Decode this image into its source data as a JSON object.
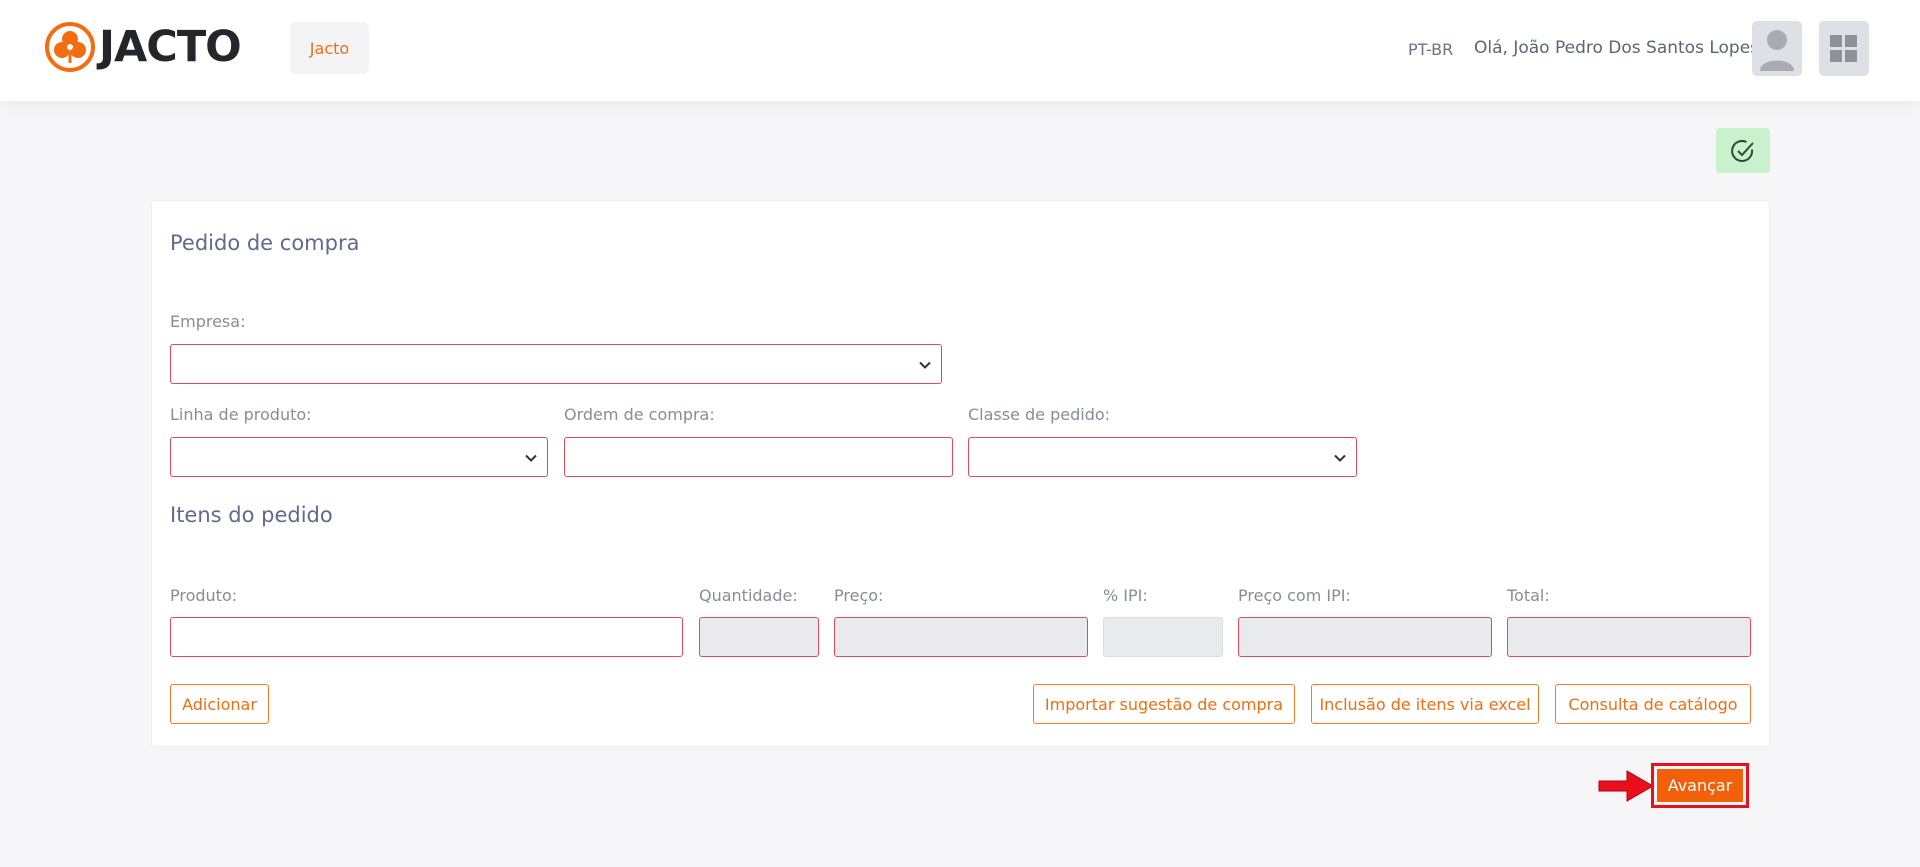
{
  "header": {
    "logo_text": "JACTO",
    "company_chip": "Jacto",
    "language": "PT-BR",
    "greeting": "Olá,  João Pedro Dos Santos Lopes"
  },
  "form": {
    "title": "Pedido de compra",
    "empresa_label": "Empresa:",
    "empresa_value": "",
    "linha_label": "Linha de produto:",
    "linha_value": "",
    "ordem_label": "Ordem de compra:",
    "ordem_value": "",
    "classe_label": "Classe de pedido:",
    "classe_value": ""
  },
  "items": {
    "title": "Itens do pedido",
    "produto_label": "Produto:",
    "quantidade_label": "Quantidade:",
    "preco_label": "Preço:",
    "ipi_label": "% IPI:",
    "preco_ipi_label": "Preço com IPI:",
    "total_label": "Total:"
  },
  "actions": {
    "adicionar": "Adicionar",
    "importar": "Importar sugestão de compra",
    "inclusao": "Inclusão de itens via excel",
    "consulta": "Consulta de catálogo",
    "avancar": "Avançar"
  },
  "icons": {
    "logo": "jacto-clover-logo-icon",
    "avatar": "user-avatar-icon",
    "apps": "apps-grid-icon",
    "check": "check-circle-icon",
    "arrow": "red-arrow-right-icon",
    "chevron": "chevron-down-icon"
  },
  "colors": {
    "brand_orange": "#f26d10",
    "field_border": "#e04b57",
    "success_bg": "#c9f2cc",
    "highlight_red": "#e8101c"
  }
}
